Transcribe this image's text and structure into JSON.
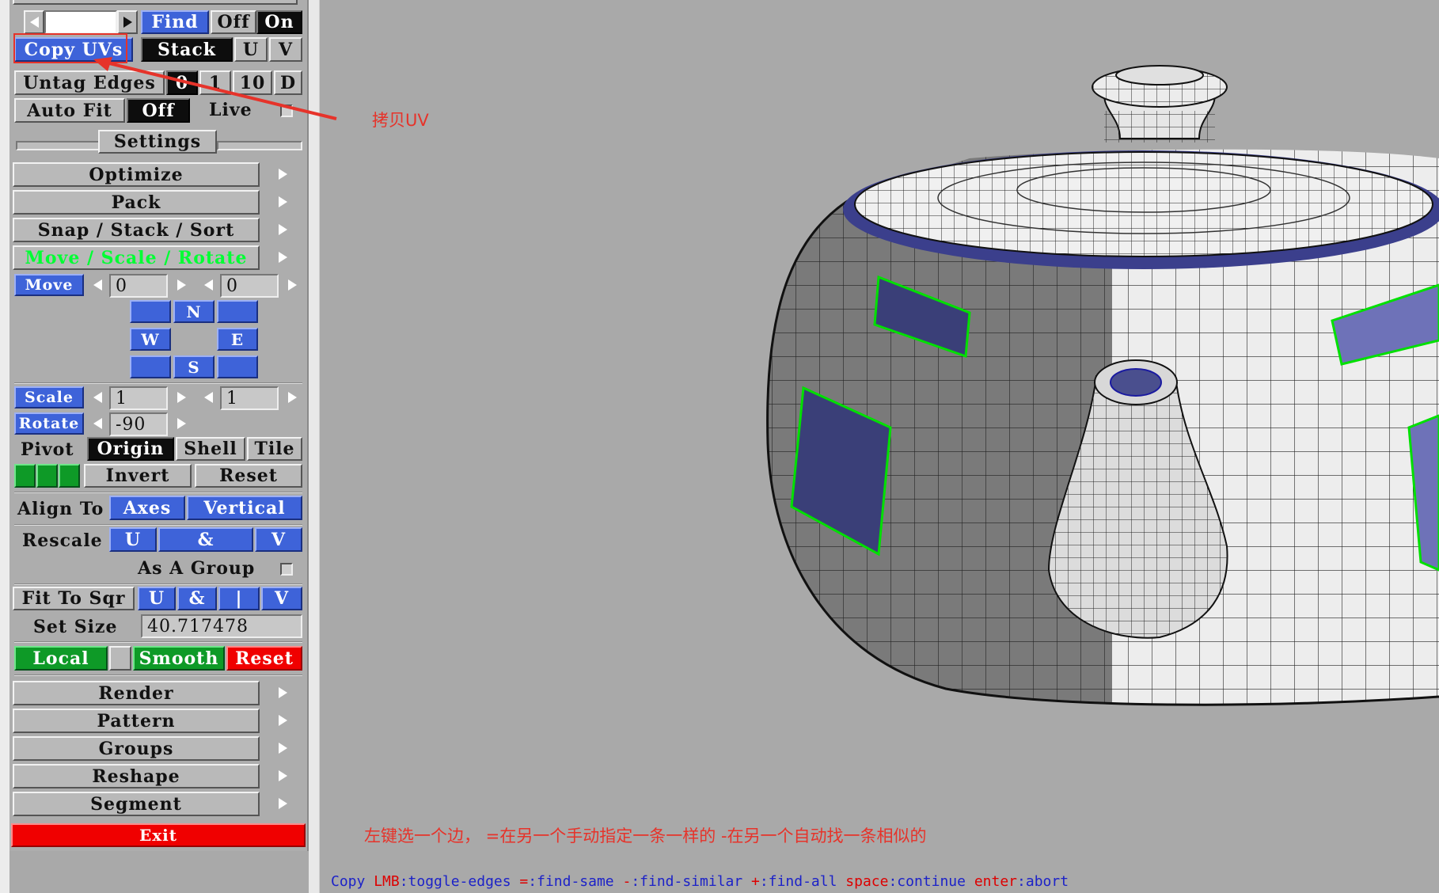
{
  "panel": {
    "find_row": {
      "value": "",
      "find": "Find",
      "off": "Off",
      "on": "On"
    },
    "copy_row": {
      "copy_uvs": "Copy UVs",
      "stack": "Stack",
      "u": "U",
      "v": "V"
    },
    "untag_row": {
      "untag_edges": "Untag Edges",
      "n0": "0",
      "n1": "1",
      "n10": "10",
      "d": "D"
    },
    "autofit_row": {
      "auto_fit": "Auto Fit",
      "off": "Off",
      "live": "Live"
    },
    "settings": "Settings",
    "menus": {
      "optimize": "Optimize",
      "pack": "Pack",
      "snap": "Snap / Stack / Sort",
      "move_scale": "Move / Scale / Rotate"
    },
    "move": {
      "label": "Move",
      "x": "0",
      "y": "0",
      "n": "N",
      "w": "W",
      "e": "E",
      "s": "S"
    },
    "scale": {
      "label": "Scale",
      "x": "1",
      "y": "1"
    },
    "rotate": {
      "label": "Rotate",
      "value": "-90"
    },
    "pivot": {
      "label": "Pivot",
      "origin": "Origin",
      "shell": "Shell",
      "tile": "Tile"
    },
    "invert_row": {
      "invert": "Invert",
      "reset": "Reset"
    },
    "align": {
      "label": "Align To",
      "axes": "Axes",
      "vertical": "Vertical"
    },
    "rescale": {
      "label": "Rescale",
      "u": "U",
      "amp": "&",
      "v": "V",
      "group": "As A Group"
    },
    "fit": {
      "label": "Fit To Sqr",
      "u": "U",
      "amp": "&",
      "bar": "|",
      "v": "V"
    },
    "set_size": {
      "label": "Set Size",
      "value": "40.717478"
    },
    "local_row": {
      "local": "Local",
      "smooth": "Smooth",
      "reset": "Reset"
    },
    "menus2": {
      "render": "Render",
      "pattern": "Pattern",
      "groups": "Groups",
      "reshape": "Reshape",
      "segment": "Segment"
    },
    "exit": "Exit"
  },
  "annotations": {
    "copy_uv": "拷贝UV",
    "instruction": "左键选一个边，  =在另一个手动指定一条一样的   -在另一个自动找一条相似的"
  },
  "status": {
    "s1": "Copy ",
    "s2": "LMB",
    "s3": ":toggle-edges ",
    "s4": "=",
    "s5": ":find-same ",
    "s6": "-",
    "s7": ":find-similar ",
    "s8": "+",
    "s9": ":find-all ",
    "s10": "space",
    "s11": ":continue ",
    "s12": "enter",
    "s13": ":abort"
  },
  "colors": {
    "blue": "#3e63d9",
    "green": "#0e9a27",
    "red": "#f00000",
    "annotation": "#e6332a",
    "bright_green_text": "#00ff33"
  }
}
